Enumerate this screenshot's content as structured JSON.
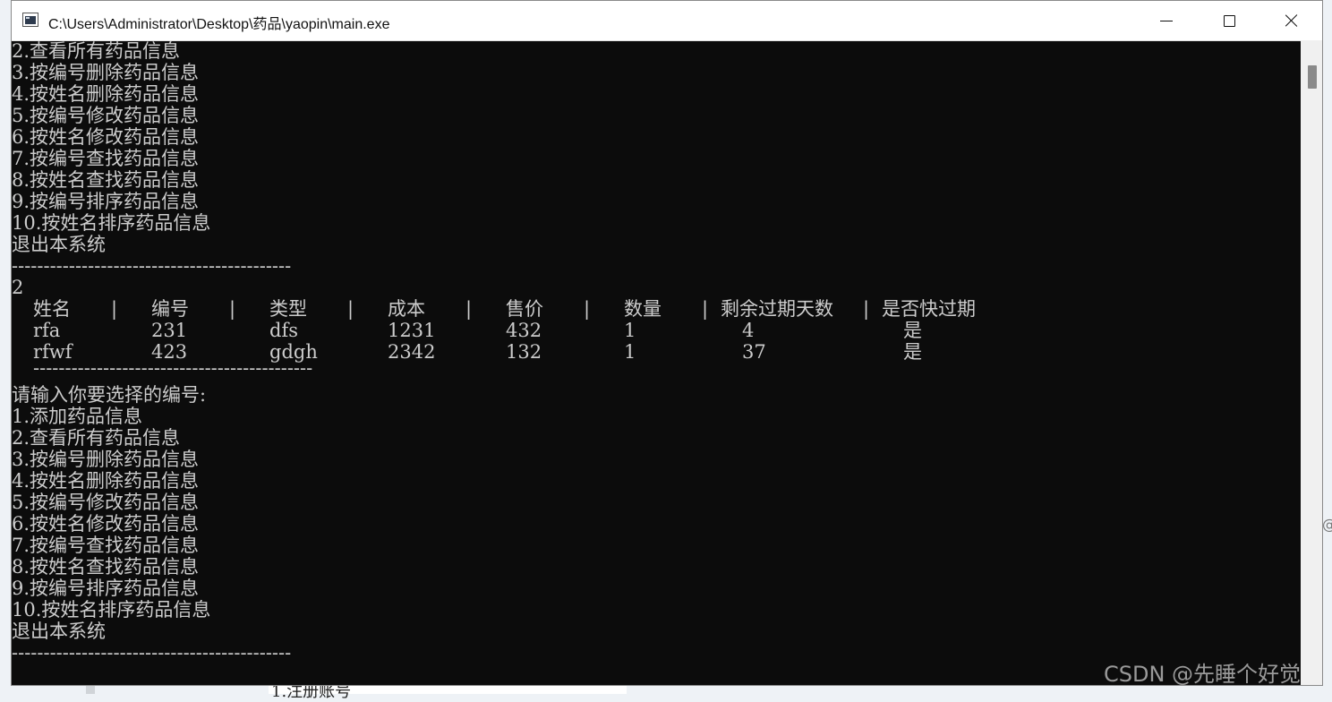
{
  "window": {
    "title": "C:\\Users\\Administrator\\Desktop\\药品\\yaopin\\main.exe"
  },
  "console": {
    "menu_top": [
      "2.查看所有药品信息",
      "3.按编号删除药品信息",
      "4.按姓名删除药品信息",
      "5.按编号修改药品信息",
      "6.按姓名修改药品信息",
      "7.按编号查找药品信息",
      "8.按姓名查找药品信息",
      "9.按编号排序药品信息",
      "10.按姓名排序药品信息",
      "退出本系统"
    ],
    "divider": "--------------------------------------------",
    "input_choice": "2",
    "table": {
      "columns": [
        "姓名",
        "编号",
        "类型",
        "成本",
        "售价",
        "数量",
        "剩余过期天数",
        "是否快过期"
      ],
      "column_separator": "|",
      "rows": [
        [
          "rfa",
          "231",
          "dfs",
          "1231",
          "432",
          "1",
          "4",
          "是"
        ],
        [
          "rfwf",
          "423",
          "gdgh",
          "2342",
          "132",
          "1",
          "37",
          "是"
        ]
      ],
      "divider": "--------------------------------------------"
    },
    "prompt": "请输入你要选择的编号:",
    "menu_bottom": [
      "1.添加药品信息",
      "2.查看所有药品信息",
      "3.按编号删除药品信息",
      "4.按姓名删除药品信息",
      "5.按编号修改药品信息",
      "6.按姓名修改药品信息",
      "7.按编号查找药品信息",
      "8.按姓名查找药品信息",
      "9.按编号排序药品信息",
      "10.按姓名排序药品信息",
      "退出本系统"
    ],
    "divider_bottom": "--------------------------------------------"
  },
  "background": {
    "peek_text": "1.注册账号",
    "at_glyph": "@"
  },
  "watermark": "CSDN @先睡个好觉",
  "colors": {
    "console_bg": "#0c0c0c",
    "console_text": "#cccccc",
    "titlebar_bg": "#ffffff"
  }
}
